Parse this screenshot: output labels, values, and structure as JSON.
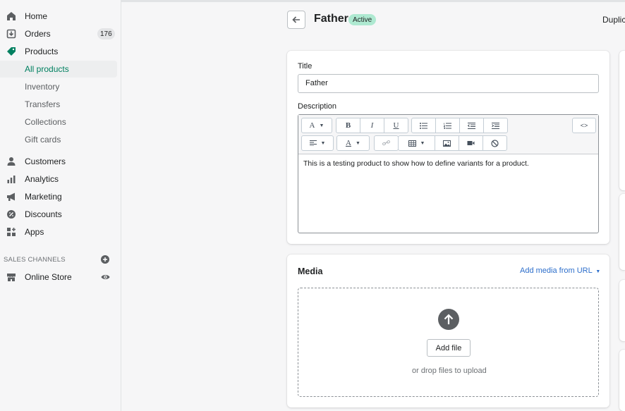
{
  "sidebar": {
    "items": [
      {
        "label": "Home",
        "icon": "home-icon"
      },
      {
        "label": "Orders",
        "icon": "orders-icon",
        "badge": "176"
      },
      {
        "label": "Products",
        "icon": "tag-icon"
      },
      {
        "label": "All products"
      },
      {
        "label": "Inventory"
      },
      {
        "label": "Transfers"
      },
      {
        "label": "Collections"
      },
      {
        "label": "Gift cards"
      },
      {
        "label": "Customers",
        "icon": "person-icon"
      },
      {
        "label": "Analytics",
        "icon": "bar-chart-icon"
      },
      {
        "label": "Marketing",
        "icon": "megaphone-icon"
      },
      {
        "label": "Discounts",
        "icon": "discount-icon"
      },
      {
        "label": "Apps",
        "icon": "apps-icon"
      }
    ],
    "sales_channels_heading": "SALES CHANNELS",
    "online_store": "Online Store"
  },
  "header": {
    "title": "Father",
    "status": "Active",
    "duplicate": "Duplica"
  },
  "form": {
    "title_label": "Title",
    "title_value": "Father",
    "description_label": "Description",
    "description_text": "This is a testing product to show how to define variants for a product."
  },
  "toolbar": {
    "font": "A",
    "bold": "B",
    "italic": "I",
    "underline": "U",
    "text_color": "A",
    "html": "<>"
  },
  "media": {
    "title": "Media",
    "add_from_url": "Add media from URL",
    "add_file": "Add file",
    "drop_hint": "or drop files to upload"
  },
  "colors": {
    "accent": "#008060",
    "link": "#2c6ecb",
    "status_bg": "#aee9d1"
  }
}
